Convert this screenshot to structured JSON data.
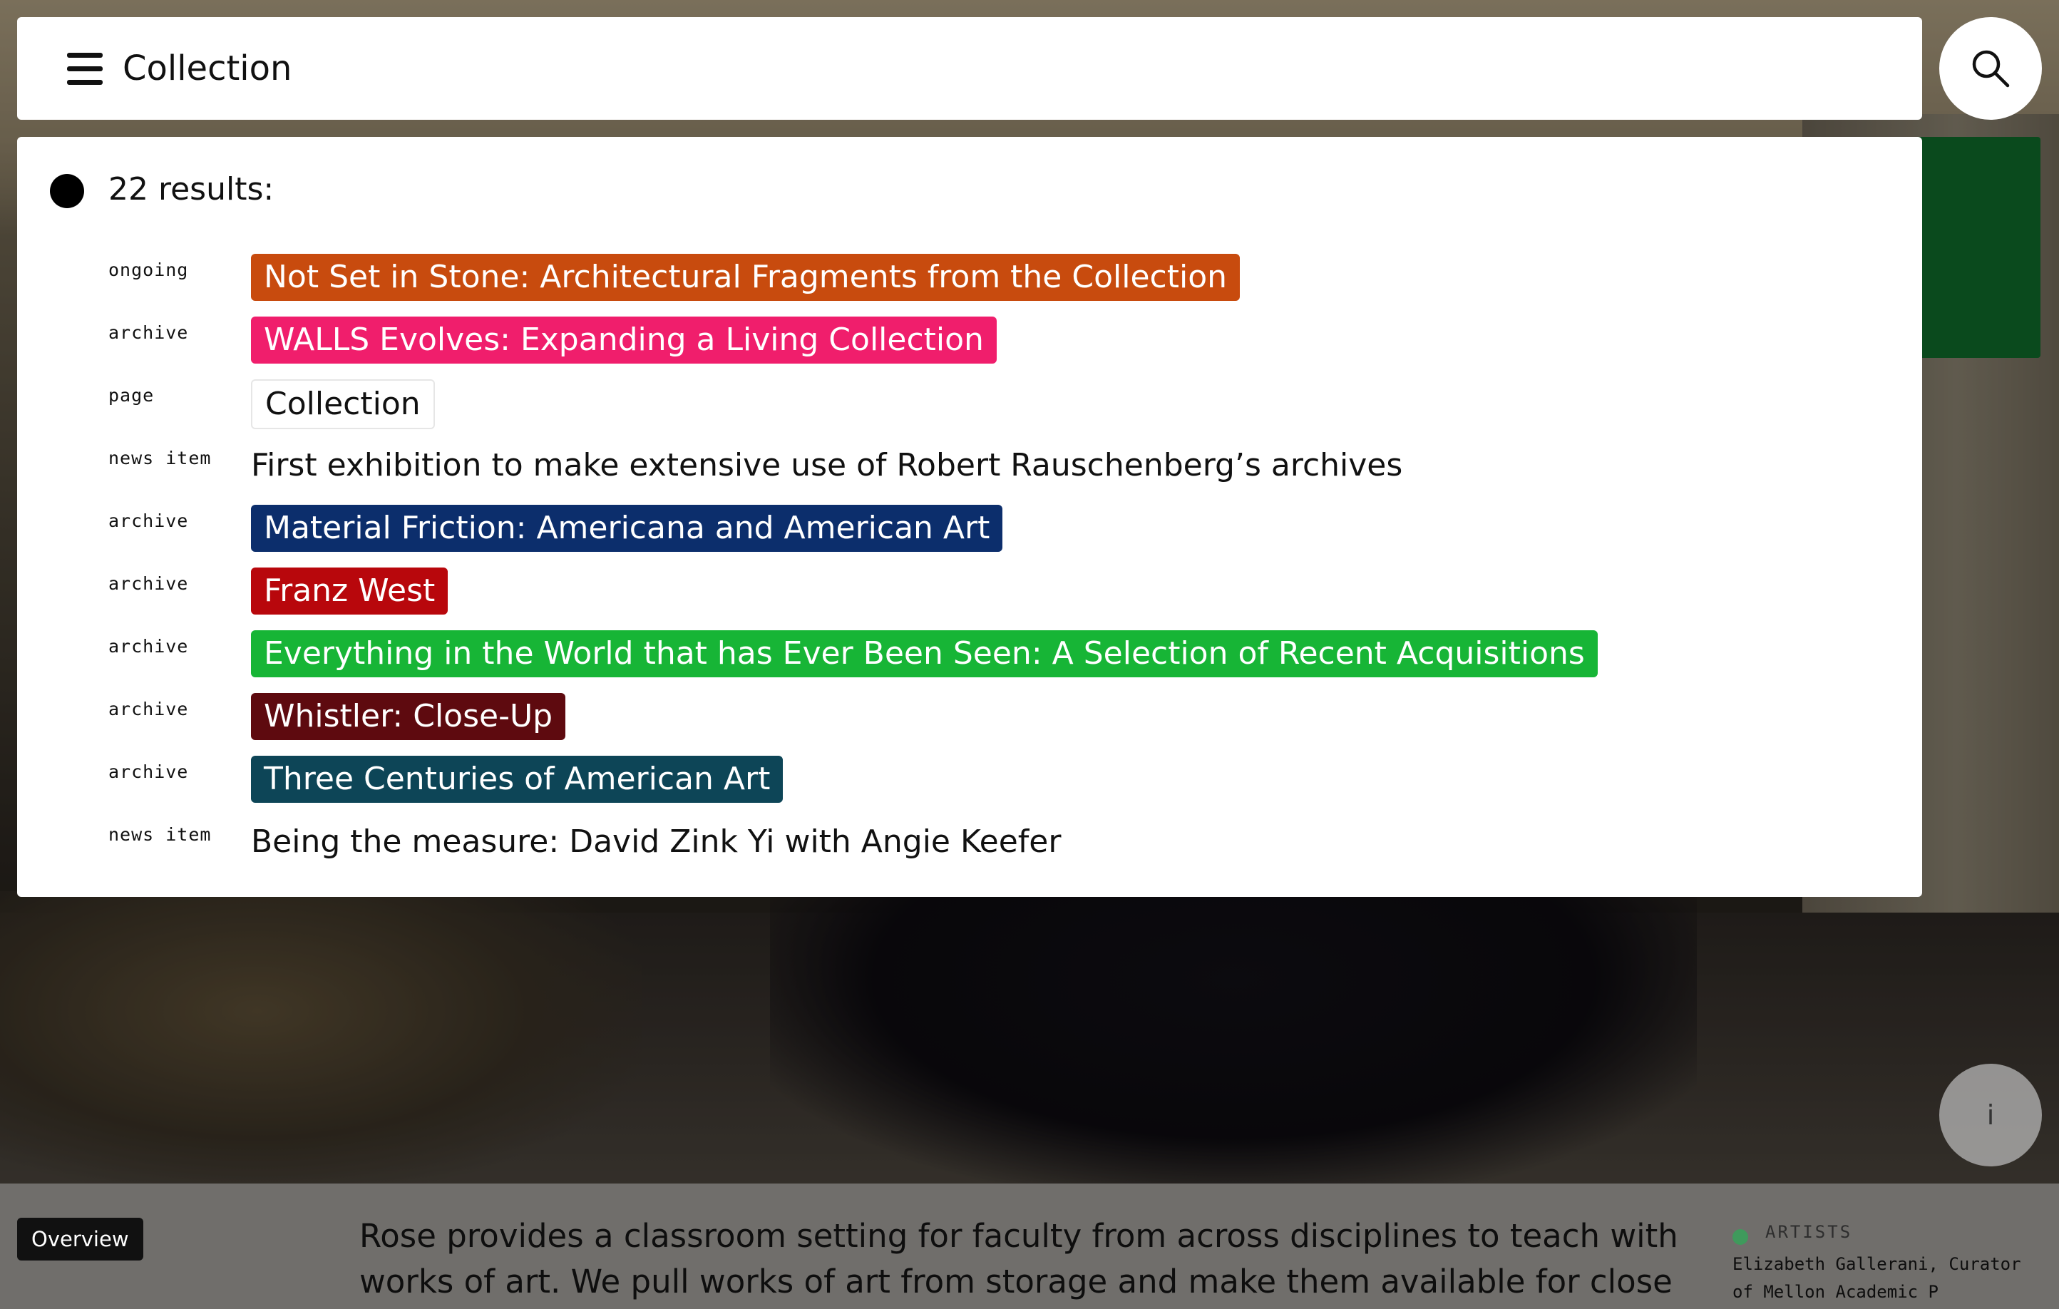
{
  "search": {
    "value": "Collection",
    "placeholder": ""
  },
  "results": {
    "count_label": "22 results:",
    "items": [
      {
        "type": "ongoing",
        "title": "Not Set in Stone: Architectural Fragments from the Collection",
        "bg": "#c84b0e",
        "fg": "#ffffff"
      },
      {
        "type": "archive",
        "title": "WALLS Evolves: Expanding a Living Collection",
        "bg": "#f01e6c",
        "fg": "#ffffff"
      },
      {
        "type": "page",
        "title": "Collection",
        "bg": "#ffffff",
        "fg": "#111111"
      },
      {
        "type": "news item",
        "title": "First exhibition to make extensive use of Robert Rauschenberg’s archives",
        "bg": "",
        "fg": "#111111"
      },
      {
        "type": "archive",
        "title": "Material Friction: Americana and American Art",
        "bg": "#0c2e6c",
        "fg": "#ffffff"
      },
      {
        "type": "archive",
        "title": "Franz West",
        "bg": "#b8070c",
        "fg": "#ffffff"
      },
      {
        "type": "archive",
        "title": "Everything in the World that has Ever Been Seen: A Selection of Recent Acquisitions",
        "bg": "#17b536",
        "fg": "#ffffff"
      },
      {
        "type": "archive",
        "title": "Whistler: Close-Up",
        "bg": "#5e0a0f",
        "fg": "#ffffff"
      },
      {
        "type": "archive",
        "title": "Three Centuries of American Art",
        "bg": "#0d4557",
        "fg": "#ffffff"
      },
      {
        "type": "news item",
        "title": "Being the measure: David Zink Yi with Angie Keefer",
        "bg": "",
        "fg": "#111111"
      }
    ]
  },
  "info_button": {
    "label": "i"
  },
  "bottom": {
    "tab_label": "Overview",
    "overview_text": "Rose provides a classroom setting for faculty from across disciplines to teach with works of art. We pull works of art from storage and make them available for close",
    "artists_label": "ARTISTS",
    "artists_text": "Elizabeth Gallerani, Curator of Mellon Academic P"
  },
  "icons": {
    "menu": "hamburger-menu-icon",
    "search": "magnifier-icon",
    "bullet": "filled-circle-icon"
  }
}
